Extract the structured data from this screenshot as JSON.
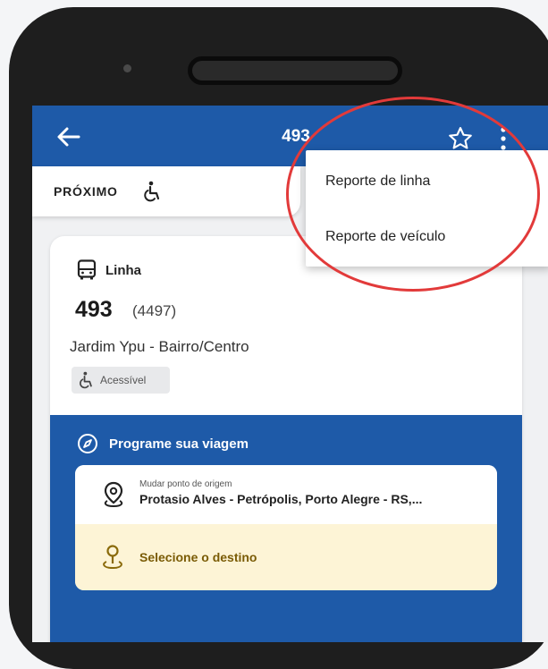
{
  "app_bar": {
    "title": "493",
    "color": "#1e5aa8"
  },
  "tabs": {
    "active_label": "PRÓXIMO"
  },
  "menu": {
    "items": [
      {
        "label": "Reporte de linha"
      },
      {
        "label": "Reporte de veículo"
      }
    ]
  },
  "line": {
    "section_label": "Linha",
    "number": "493",
    "code": "(4497)",
    "route": "Jardim Ypu - Bairro/Centro",
    "badge": "Acessível"
  },
  "plan": {
    "title": "Programe sua viagem",
    "origin_hint": "Mudar ponto de origem",
    "origin_value": "Protasio Alves - Petrópolis, Porto Alegre - RS,...",
    "destination_label": "Selecione o destino",
    "destination_color": "#7a5b05"
  },
  "highlight_color": "#e23a3a"
}
